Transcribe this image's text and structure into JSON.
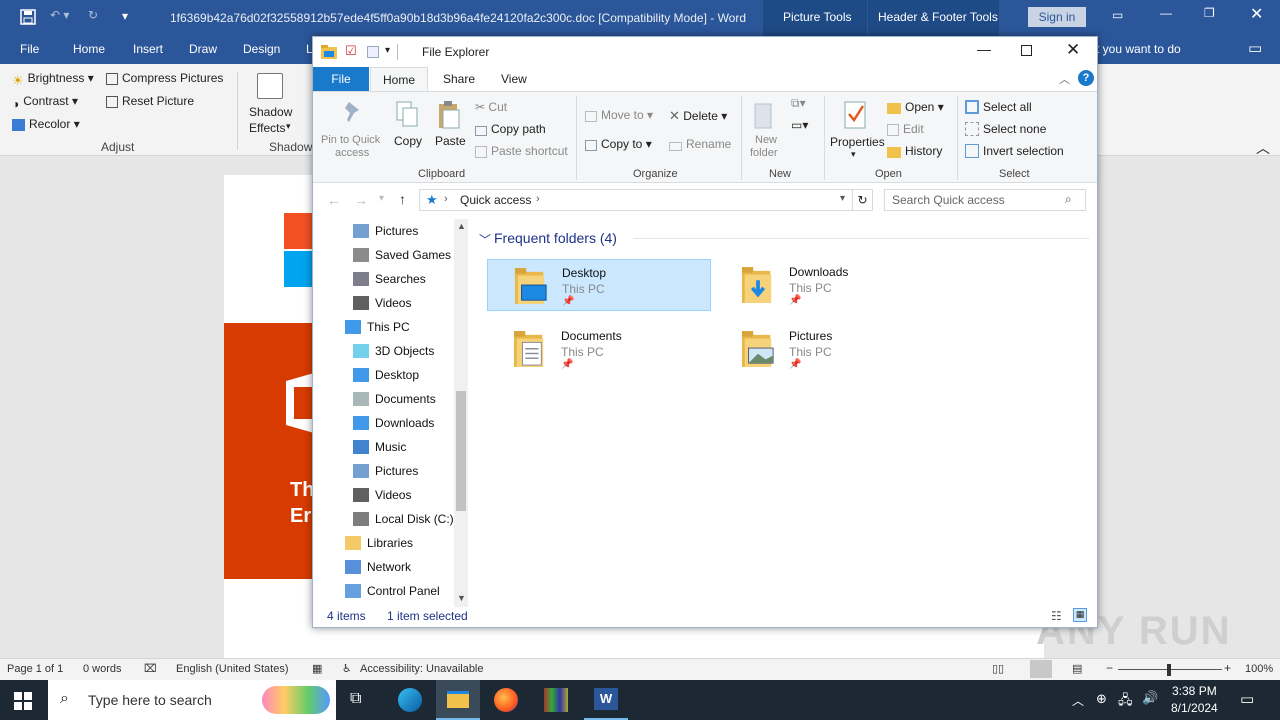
{
  "word": {
    "title": "1f6369b42a76d02f32558912b57ede4f5ff0a90b18d3b96a4fe24120fa2c300c.doc [Compatibility Mode]  -  Word",
    "context_tabs": [
      "Picture Tools",
      "Header & Footer Tools"
    ],
    "sign_in": "Sign in",
    "tabs": [
      "File",
      "Home",
      "Insert",
      "Draw",
      "Design",
      "L"
    ],
    "tell_me": "t you want to do",
    "ribbon": {
      "brightness": "Brightness",
      "contrast": "Contrast",
      "recolor": "Recolor",
      "compress": "Compress Pictures",
      "reset": "Reset Picture",
      "shadow_effects_1": "Shadow",
      "shadow_effects_2": "Effects",
      "shadow_group": "Shadow",
      "adjust_group": "Adjust"
    },
    "doc_text": [
      "Th",
      "Er"
    ],
    "status": {
      "page": "Page 1 of 1",
      "words": "0 words",
      "language": "English (United States)",
      "accessibility": "Accessibility: Unavailable",
      "zoom": "100%"
    }
  },
  "explorer": {
    "title": "File Explorer",
    "tabs": [
      "File",
      "Home",
      "Share",
      "View"
    ],
    "ribbon": {
      "pin": [
        "Pin to Quick",
        "access"
      ],
      "copy": "Copy",
      "paste": "Paste",
      "cut": "Cut",
      "copy_path": "Copy path",
      "paste_shortcut": "Paste shortcut",
      "move_to": "Move to",
      "copy_to": "Copy to",
      "delete": "Delete",
      "rename": "Rename",
      "new_folder": [
        "New",
        "folder"
      ],
      "properties": "Properties",
      "open": "Open",
      "edit": "Edit",
      "history": "History",
      "select_all": "Select all",
      "select_none": "Select none",
      "invert": "Invert selection",
      "groups": [
        "Clipboard",
        "Organize",
        "New",
        "Open",
        "Select"
      ]
    },
    "address": {
      "location": "Quick access",
      "search_placeholder": "Search Quick access"
    },
    "nav": [
      {
        "label": "Pictures",
        "icon": "pictures-icon"
      },
      {
        "label": "Saved Games",
        "icon": "saved-games-icon"
      },
      {
        "label": "Searches",
        "icon": "searches-icon"
      },
      {
        "label": "Videos",
        "icon": "videos-icon"
      },
      {
        "label": "This PC",
        "icon": "this-pc-icon"
      },
      {
        "label": "3D Objects",
        "icon": "3d-objects-icon"
      },
      {
        "label": "Desktop",
        "icon": "desktop-icon"
      },
      {
        "label": "Documents",
        "icon": "documents-icon"
      },
      {
        "label": "Downloads",
        "icon": "downloads-icon"
      },
      {
        "label": "Music",
        "icon": "music-icon"
      },
      {
        "label": "Pictures",
        "icon": "pictures-icon"
      },
      {
        "label": "Videos",
        "icon": "videos-icon"
      },
      {
        "label": "Local Disk (C:)",
        "icon": "disk-icon"
      },
      {
        "label": "Libraries",
        "icon": "libraries-icon"
      },
      {
        "label": "Network",
        "icon": "network-icon"
      },
      {
        "label": "Control Panel",
        "icon": "control-panel-icon"
      }
    ],
    "section_title": "Frequent folders (4)",
    "folders": [
      {
        "name": "Desktop",
        "sub": "This PC",
        "selected": true
      },
      {
        "name": "Downloads",
        "sub": "This PC",
        "selected": false
      },
      {
        "name": "Documents",
        "sub": "This PC",
        "selected": false
      },
      {
        "name": "Pictures",
        "sub": "This PC",
        "selected": false
      }
    ],
    "status": {
      "items": "4 items",
      "selected": "1 item selected"
    }
  },
  "taskbar": {
    "search_placeholder": "Type here to search",
    "time": "3:38 PM",
    "date": "8/1/2024"
  },
  "watermark": "ANY RUN",
  "colors": {
    "word_blue": "#2b579a",
    "selection": "#cce8ff",
    "accent": "#0078d7"
  }
}
